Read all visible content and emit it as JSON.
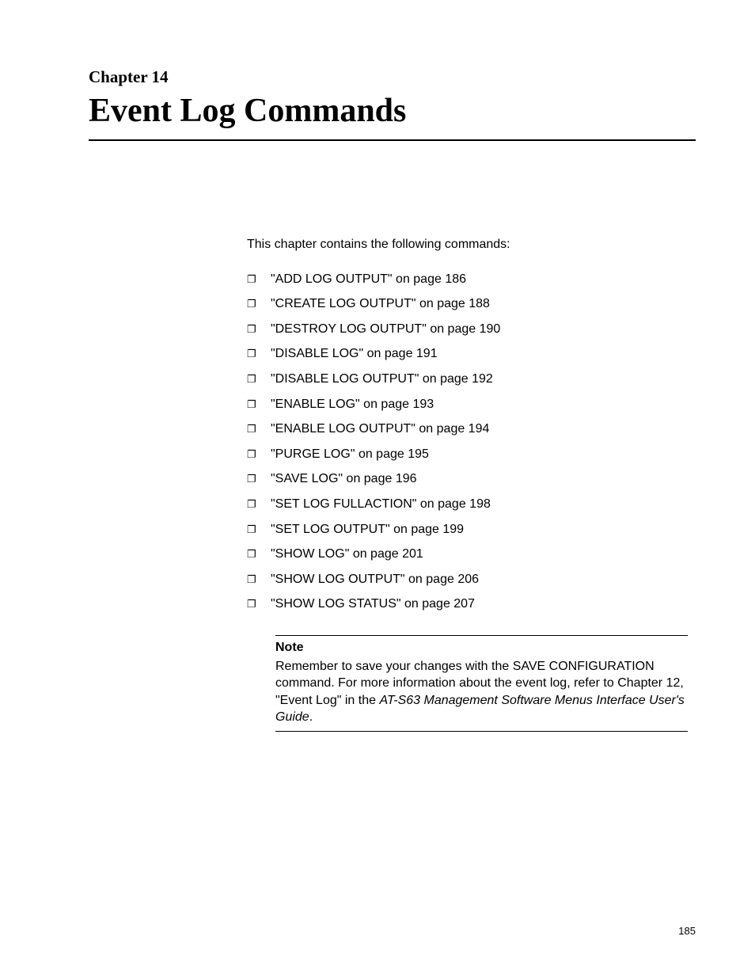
{
  "chapter": {
    "label": "Chapter 14",
    "title": "Event Log Commands"
  },
  "intro": "This chapter contains the following commands:",
  "commands": [
    {
      "text": "\"ADD LOG OUTPUT\" on page 186"
    },
    {
      "text": "\"CREATE LOG OUTPUT\" on page 188"
    },
    {
      "text": "\"DESTROY LOG OUTPUT\" on page 190"
    },
    {
      "text": "\"DISABLE LOG\" on page 191"
    },
    {
      "text": "\"DISABLE LOG OUTPUT\" on page 192"
    },
    {
      "text": "\"ENABLE LOG\" on page 193"
    },
    {
      "text": "\"ENABLE LOG OUTPUT\" on page 194"
    },
    {
      "text": "\"PURGE LOG\" on page 195"
    },
    {
      "text": "\"SAVE LOG\" on page 196"
    },
    {
      "text": "\"SET LOG FULLACTION\" on page 198"
    },
    {
      "text": "\"SET LOG OUTPUT\" on page 199"
    },
    {
      "text": "\"SHOW LOG\" on page 201"
    },
    {
      "text": "\"SHOW LOG OUTPUT\" on page 206"
    },
    {
      "text": "\"SHOW LOG STATUS\" on page 207"
    }
  ],
  "note": {
    "heading": "Note",
    "line1": "Remember to save your changes with the SAVE CONFIGURATION command. For more information about the event log, refer to Chapter 12, \"Event Log\" in the ",
    "italic": "AT-S63 Management Software Menus Interface User's Guide",
    "after": "."
  },
  "page_number": "185"
}
